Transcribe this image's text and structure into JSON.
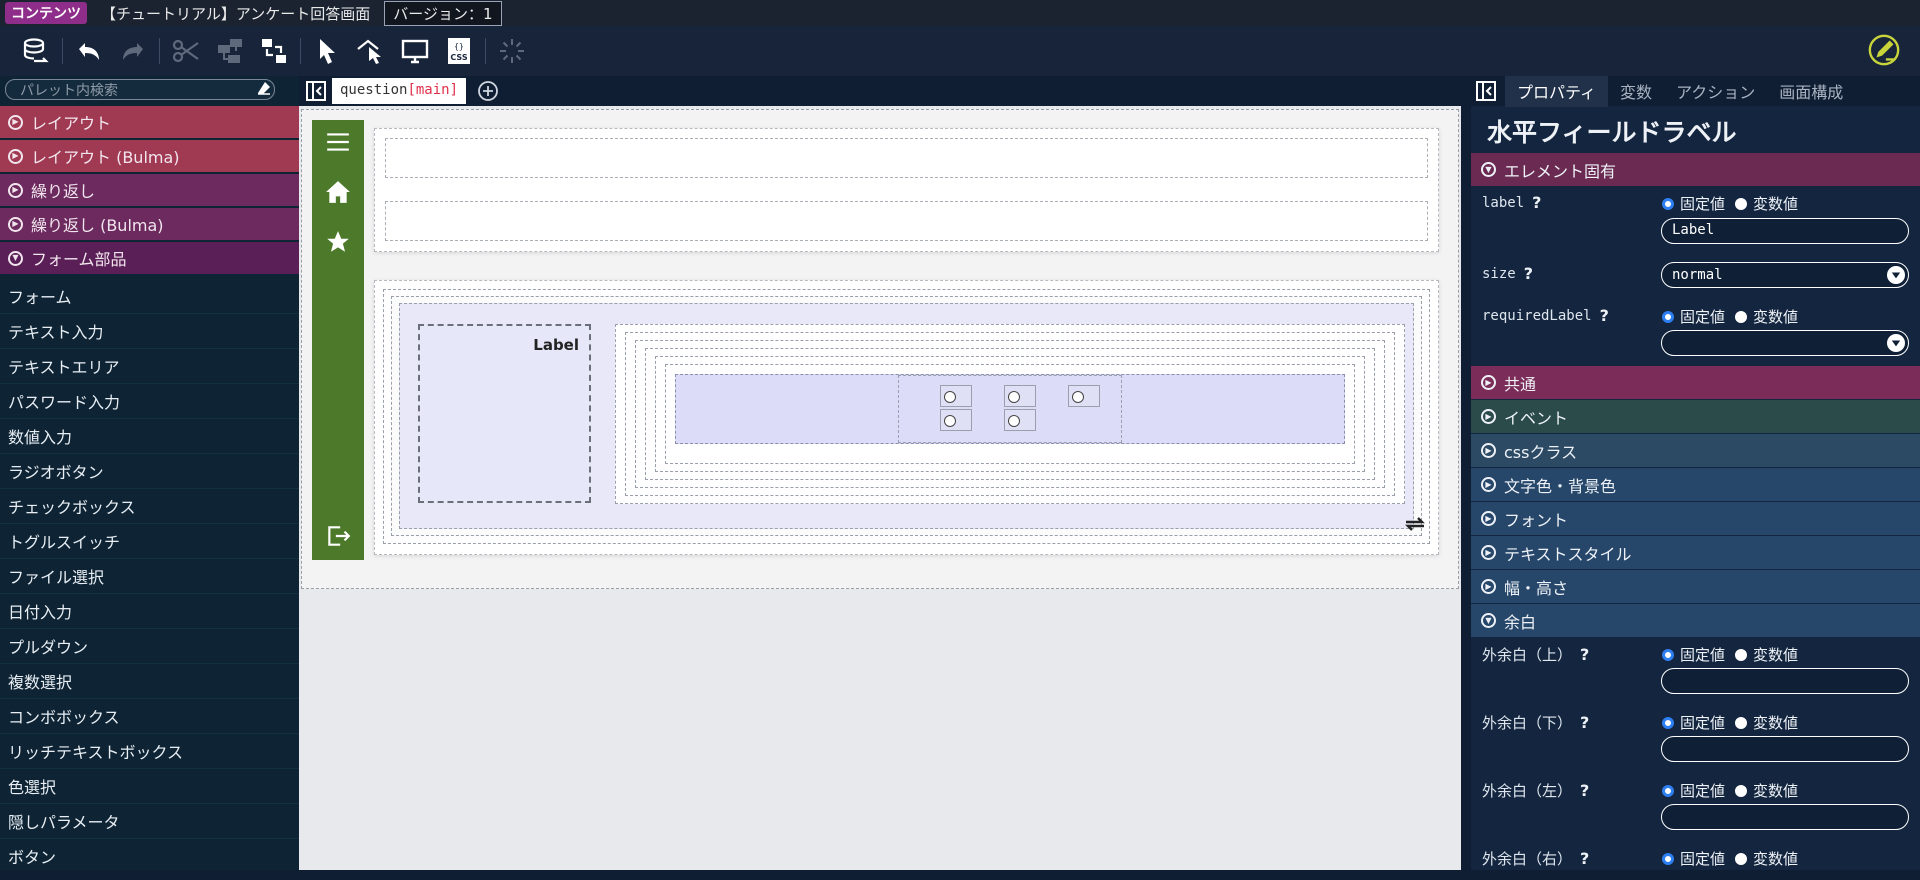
{
  "titlebar": {
    "badge": "コンテンツ",
    "title": "【チュートリアル】アンケート回答画面",
    "version": "バージョン：1"
  },
  "toolbar": {
    "icons": [
      "database-icon",
      "undo-icon",
      "redo-icon",
      "cut-icon",
      "copy-icon",
      "swap-icon",
      "pointer-icon",
      "select-mode-icon",
      "preview-icon",
      "css-icon",
      "loading-icon",
      "edit-icon"
    ]
  },
  "palette": {
    "search_placeholder": "パレット内検索",
    "categories": {
      "layout": "レイアウト",
      "layout_bulma": "レイアウト (Bulma)",
      "repeat": "繰り返し",
      "repeat_bulma": "繰り返し (Bulma)",
      "form_parts": "フォーム部品"
    },
    "items": [
      "フォーム",
      "テキスト入力",
      "テキストエリア",
      "パスワード入力",
      "数値入力",
      "ラジオボタン",
      "チェックボックス",
      "トグルスイッチ",
      "ファイル選択",
      "日付入力",
      "プルダウン",
      "複数選択",
      "コンボボックス",
      "リッチテキストボックス",
      "色選択",
      "隠しパラメータ",
      "ボタン"
    ]
  },
  "canvas": {
    "tab_name": "question",
    "tab_suffix": "[main]",
    "label_text": "Label"
  },
  "properties": {
    "tabs": [
      "プロパティ",
      "変数",
      "アクション",
      "画面構成"
    ],
    "active_tab": "プロパティ",
    "title": "水平フィールドラベル",
    "sections": {
      "own": "エレメント固有",
      "common": "共通",
      "event": "イベント",
      "css_class": "cssクラス",
      "color": "文字色・背景色",
      "font": "フォント",
      "text_style": "テキストスタイル",
      "size": "幅・高さ",
      "margin": "余白"
    },
    "fixed_label": "固定値",
    "variable_label": "変数値",
    "help": "?",
    "fields": {
      "label_name": "label",
      "label_value": "Label",
      "size_name": "size",
      "size_value": "normal",
      "required_name": "requiredLabel",
      "required_value": "",
      "margin_top": "外余白（上）",
      "margin_bottom": "外余白（下）",
      "margin_left": "外余白（左）",
      "margin_right": "外余白（右）"
    }
  },
  "colors": {
    "layout_category": "#a03a52",
    "repeat_category": "#6c2a5e",
    "form_category": "#5b1f57",
    "nav_green": "#4d7a2a",
    "accent_blue": "#2d7ef0",
    "brand_badge": "#8e2e8a"
  }
}
